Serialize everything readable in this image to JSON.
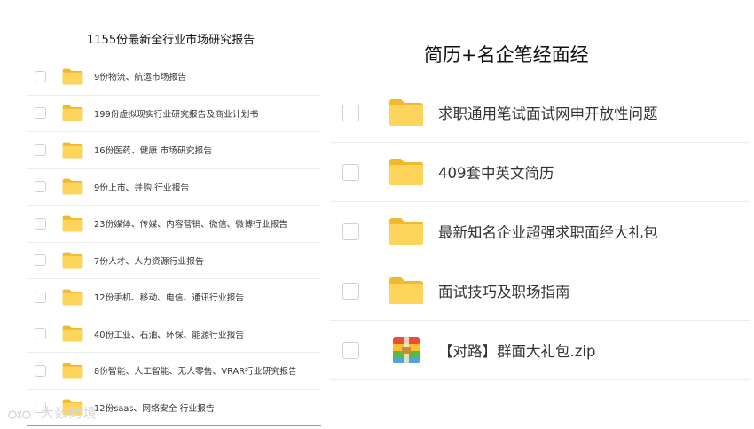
{
  "left": {
    "title": "1155份最新全行业市场研究报告",
    "items": [
      {
        "label": "9份物流、航运市场报告",
        "icon": "folder-icon"
      },
      {
        "label": "199份虚拟现实行业研究报告及商业计划书",
        "icon": "folder-icon"
      },
      {
        "label": "16份医药、健康 市场研究报告",
        "icon": "folder-icon"
      },
      {
        "label": "9份上市、并购 行业报告",
        "icon": "folder-icon"
      },
      {
        "label": "23份媒体、传媒、内容营销、微信、微博行业报告",
        "icon": "folder-icon"
      },
      {
        "label": "7份人才、人力资源行业报告",
        "icon": "folder-icon"
      },
      {
        "label": "12份手机、移动、电信、通讯行业报告",
        "icon": "folder-icon"
      },
      {
        "label": "40份工业、石油、环保、能源行业报告",
        "icon": "folder-icon"
      },
      {
        "label": "8份智能、人工智能、无人零售、VRAR行业研究报告",
        "icon": "folder-icon"
      },
      {
        "label": "12份saas、网络安全 行业报告",
        "icon": "folder-icon"
      }
    ]
  },
  "right": {
    "title": "简历+名企笔经面经",
    "items": [
      {
        "label": "求职通用笔试面试网申开放性问题",
        "icon": "folder-icon"
      },
      {
        "label": "409套中英文简历",
        "icon": "folder-icon"
      },
      {
        "label": "最新知名企业超强求职面经大礼包",
        "icon": "folder-icon"
      },
      {
        "label": "面试技巧及职场指南",
        "icon": "folder-icon"
      },
      {
        "label": "【对路】群面大礼包.zip",
        "icon": "zip-archive-icon"
      }
    ]
  },
  "watermark": {
    "text": "大数跨境"
  },
  "colors": {
    "folder_back": "#f2b92f",
    "folder_front": "#fcd55a",
    "row_divider": "#ececec",
    "checkbox_border": "#cfcfcf",
    "text": "#333333"
  }
}
